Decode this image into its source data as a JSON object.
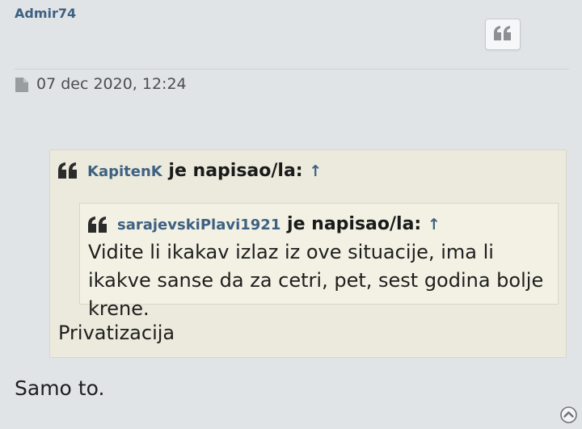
{
  "post": {
    "author": "Admir74",
    "date": "07 dec 2020, 12:24",
    "outer_quote": {
      "user": "KapitenK",
      "wrote": "je napisao/la:",
      "arrow": "↑",
      "text": "Privatizacija"
    },
    "inner_quote": {
      "user": "sarajevskiPlavi1921",
      "wrote": "je napisao/la:",
      "arrow": "↑",
      "text": "Vidite li ikakav izlaz iz ove situacije, ima li ikakve sanse da za cetri, pet, sest godina bolje krene."
    },
    "body_text": "Samo to."
  },
  "icons": {
    "quote_button": "quote-icon",
    "post_link": "file-icon",
    "blockquote": "quote-left-icon",
    "back_to_top": "chevron-circle-up-icon"
  },
  "colors": {
    "page_bg": "#e1e4e7",
    "link": "#3e6182",
    "quote_bg": "#ebeadd",
    "inner_quote_bg": "#f2f1e4"
  }
}
